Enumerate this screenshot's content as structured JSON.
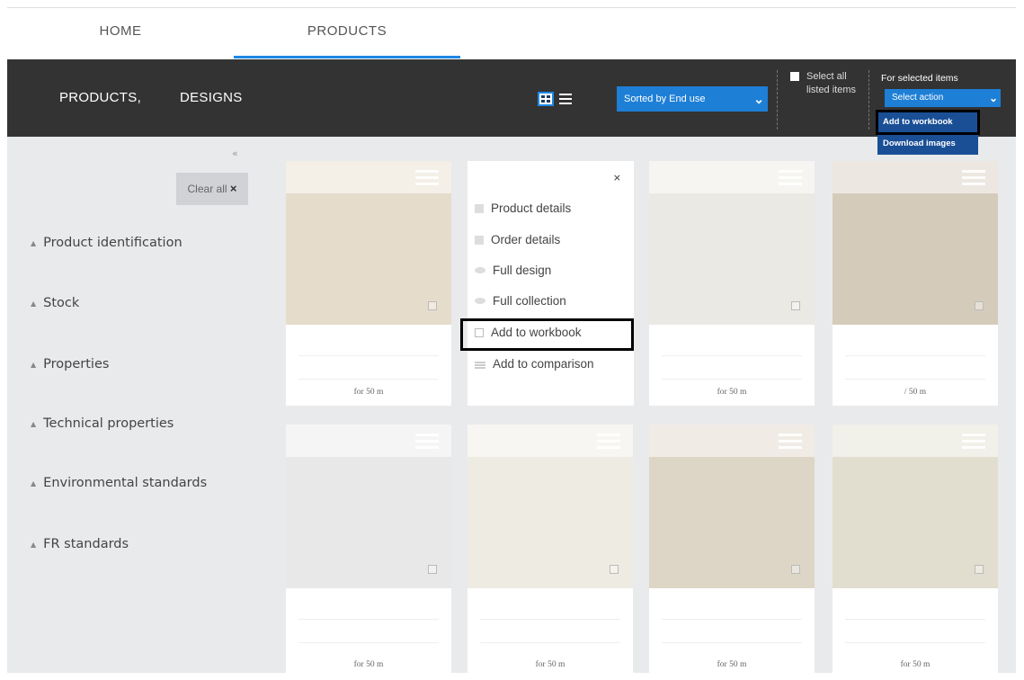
{
  "tabs": [
    {
      "label": "HOME",
      "active": false
    },
    {
      "label": "PRODUCTS",
      "active": true
    }
  ],
  "toolbar": {
    "products_label": "PRODUCTS,",
    "designs_label": "DESIGNS",
    "sort_value": "Sorted by End use",
    "select_all_label": "Select all listed items",
    "for_selected_label": "For selected items",
    "action_value": "Select action",
    "action_options": [
      "Add to workbook",
      "Download images"
    ],
    "accent_color": "#1e7fd6"
  },
  "sidebar": {
    "clear_all_label": "Clear all",
    "clear_all_icon": "×",
    "collapse_icon": "«",
    "facets": [
      "Product identification",
      "Stock",
      "Properties",
      "Technical properties",
      "Environmental standards",
      "FR standards"
    ]
  },
  "popup_menu": {
    "close_icon": "×",
    "items": [
      "Product details",
      "Order details",
      "Full design",
      "Full collection",
      "Add to workbook",
      "Add to comparison"
    ]
  },
  "products": [
    {
      "price_label": "for 50 m",
      "color": "#e6dccb"
    },
    {
      "price_label": "",
      "color": "#ffffff"
    },
    {
      "price_label": "for 50 m",
      "color": "#ebe9e3"
    },
    {
      "price_label": "/ 50 m",
      "color": "#d5cbbb"
    },
    {
      "price_label": "for 50 m",
      "color": "#e8e8e9"
    },
    {
      "price_label": "for 50 m",
      "color": "#eeebe2"
    },
    {
      "price_label": "for 50 m",
      "color": "#ddd6c6"
    },
    {
      "price_label": "for 50 m",
      "color": "#e1ddcf"
    }
  ]
}
